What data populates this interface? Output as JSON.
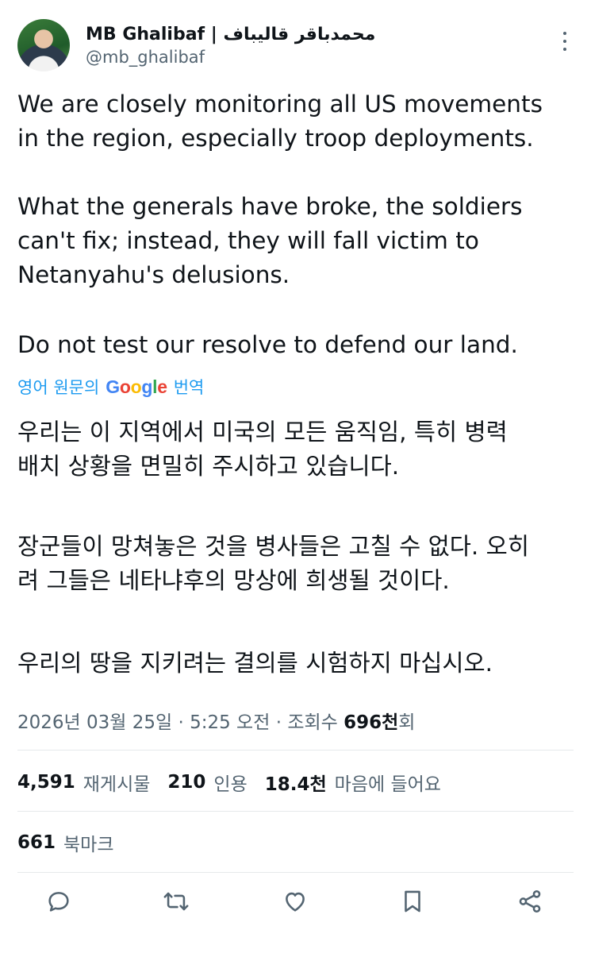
{
  "author": {
    "name": "MB Ghalibaf | محمدباقر قالیباف",
    "handle": "@mb_ghalibaf"
  },
  "tweet": {
    "lines_en_1": [
      "We are closely monitoring all US movements",
      "in the region, especially troop deployments."
    ],
    "lines_en_2": [
      "What the generals have broke, the soldiers",
      "can't fix; instead, they will fall victim to",
      "Netanyahu's delusions."
    ],
    "lines_en_3": [
      "Do not test our resolve to defend our land."
    ]
  },
  "translation": {
    "prefix": "영어 원문의",
    "google": "Google",
    "suffix": "번역"
  },
  "translated": {
    "lines_ko_1": [
      "우리는 이 지역에서 미국의 모든 움직임, 특히 병력",
      "배치 상황을 면밀히 주시하고 있습니다."
    ],
    "lines_ko_2": [
      "장군들이 망쳐놓은 것을 병사들은 고칠 수 없다. 오히",
      "려 그들은 네타냐후의 망상에 희생될 것이다."
    ],
    "lines_ko_3": [
      "우리의 땅을 지키려는 결의를 시험하지 마십시오."
    ]
  },
  "meta": {
    "timestamp": "2026년 03월 25일 · 5:25 오전 · 조회수 ",
    "views": "696천",
    "views_suffix": "회"
  },
  "stats": {
    "reposts_count": "4,591",
    "reposts_label": "재게시물",
    "quotes_count": "210",
    "quotes_label": "인용",
    "likes_count": "18.4천",
    "likes_label": "마음에 들어요",
    "bookmarks_count": "661",
    "bookmarks_label": "북마크"
  },
  "actions": [
    "reply-icon",
    "repost-icon",
    "like-icon",
    "bookmark-icon",
    "share-icon"
  ],
  "colors": {
    "text": "#0f1419",
    "secondary": "#536471",
    "link": "#1d9bf0",
    "divider": "#e6e9eb"
  }
}
